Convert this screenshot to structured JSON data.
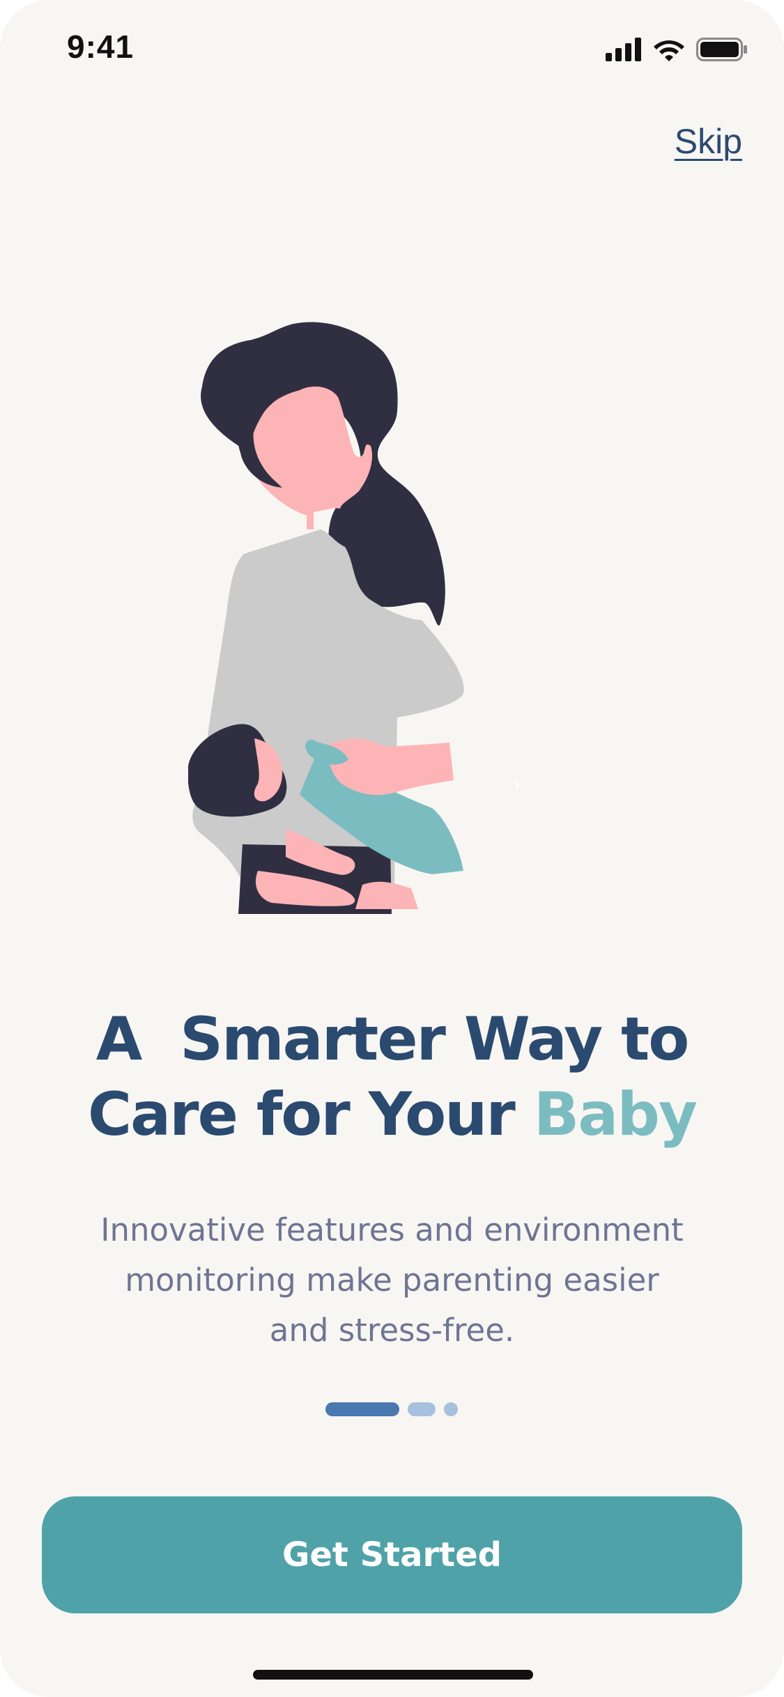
{
  "status_bar": {
    "time": "9:41"
  },
  "header": {
    "skip_label": "Skip"
  },
  "illustration": {
    "name": "mother-holding-baby-illustration",
    "colors": {
      "hair": "#302f42",
      "skin": "#fdb4b6",
      "shirt": "#cbcbcb",
      "baby_clothes": "#7bbcc1"
    }
  },
  "onboarding": {
    "headline_line1": "A  Smarter Way to",
    "headline_line2_prefix": "Care for Your ",
    "headline_accent": "Baby",
    "description_line1": "Innovative features and environment",
    "description_line2": "monitoring make parenting easier",
    "description_line3": "and stress-free.",
    "page_indicator": {
      "current": 1,
      "total": 3
    },
    "cta_label": "Get Started"
  },
  "colors": {
    "background": "#f8f6f3",
    "primary": "#2b4a70",
    "accent": "#7bbcc1",
    "button": "#4fa3a8",
    "text_muted": "#6e7593"
  }
}
